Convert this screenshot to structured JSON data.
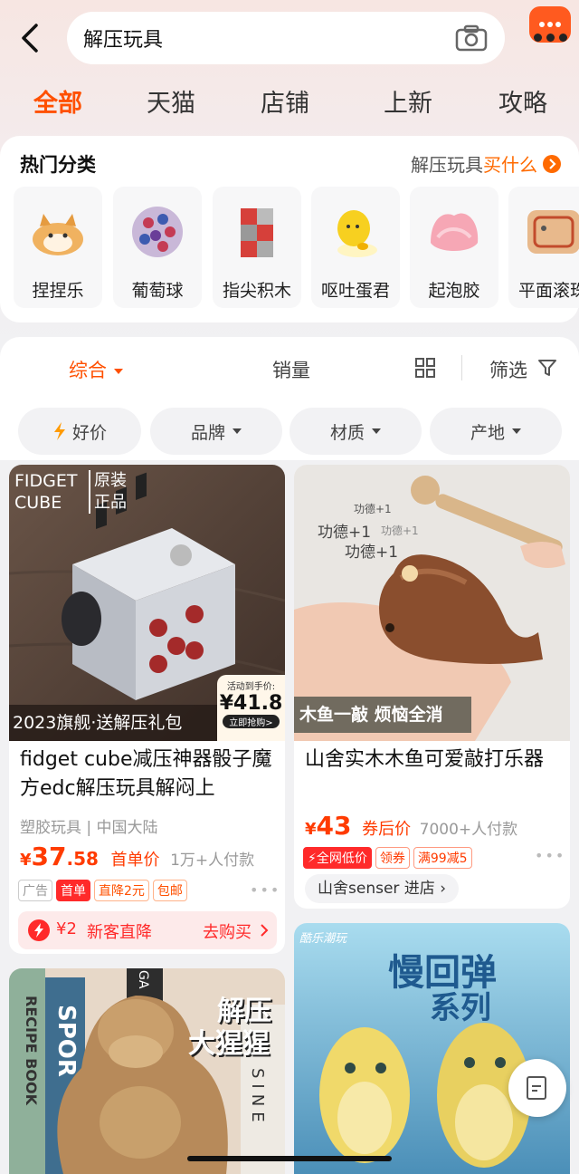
{
  "search": {
    "query": "解压玩具"
  },
  "tabs": [
    "全部",
    "天猫",
    "店铺",
    "上新",
    "攻略"
  ],
  "hot": {
    "title": "热门分类",
    "link_prefix": "解压玩具",
    "link_highlight": "买什么",
    "items": [
      "捏捏乐",
      "葡萄球",
      "指尖积木",
      "呕吐蛋君",
      "起泡胶",
      "平面滚珠"
    ]
  },
  "sort": {
    "comprehensive": "综合",
    "sales": "销量",
    "filter": "筛选"
  },
  "chips": [
    "好价",
    "品牌",
    "材质",
    "产地"
  ],
  "product1": {
    "badge_brand_line1": "FIDGET",
    "badge_brand_line2": "CUBE",
    "badge_auth_line1": "原装",
    "badge_auth_line2": "正品",
    "banner": "2023旗舰·送解压礼包",
    "price_tag_label": "活动到手价:",
    "price_tag_value": "¥41.8",
    "price_tag_btn": "立即抢购>",
    "title": "fidget cube减压神器骰子魔方edc解压玩具解闷上",
    "meta1": "塑胶玩具",
    "meta2": "中国大陆",
    "price_symbol": "¥",
    "price_int": "37",
    "price_dec": ".58",
    "price_label": "首单价",
    "buyers": "1万+人付款",
    "tag_ad": "广告",
    "tag_first": "首单",
    "tag_discount": "直降2元",
    "tag_ship": "包邮"
  },
  "promo": {
    "amount": "¥2",
    "text": "新客直降",
    "action": "去购买"
  },
  "product2": {
    "overlay1": "功德+1",
    "overlay2": "功德+1",
    "overlay3": "功德+1",
    "overlay4": "功德+1",
    "banner": "木鱼一敲 烦恼全消",
    "title": "山舍实木木鱼可爱敲打乐器",
    "price_symbol": "¥",
    "price_int": "43",
    "price_label": "券后价",
    "buyers": "7000+人付款",
    "tag_lowest": "全网低价",
    "tag_coupon": "领券",
    "tag_offer": "满99减5",
    "shop": "山舍senser 进店"
  },
  "product3": {
    "overlay1": "解压",
    "overlay2": "大猩猩",
    "book1": "RECIPE BOOK",
    "book2": "SPOR",
    "book3": "SINE",
    "book4": "GA"
  },
  "product4": {
    "brand": "酷乐潮玩",
    "overlay1": "慢回弹",
    "overlay2": "系列"
  },
  "colors": {
    "accent": "#ff5000",
    "price": "#ff3b00",
    "banner_dark": "#3a2a22"
  }
}
